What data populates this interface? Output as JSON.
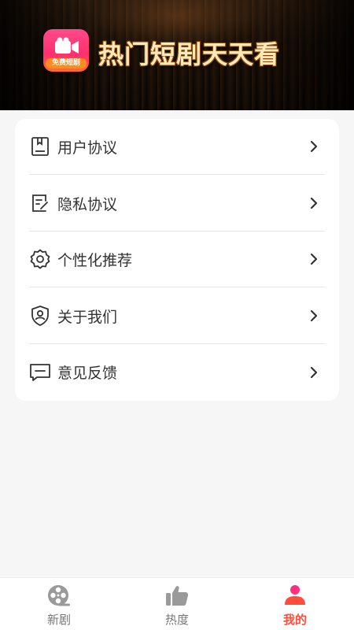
{
  "header": {
    "logo_badge": "免费短剧",
    "title": "热门短剧天天看"
  },
  "menu": {
    "items": [
      {
        "label": "用户协议",
        "icon": "agreement-book-icon"
      },
      {
        "label": "隐私协议",
        "icon": "privacy-document-icon"
      },
      {
        "label": "个性化推荐",
        "icon": "settings-gear-icon"
      },
      {
        "label": "关于我们",
        "icon": "shield-user-icon"
      },
      {
        "label": "意见反馈",
        "icon": "feedback-message-icon"
      }
    ]
  },
  "bottom_nav": {
    "items": [
      {
        "label": "新剧",
        "icon": "film-reel-icon",
        "active": false
      },
      {
        "label": "热度",
        "icon": "thumbs-up-icon",
        "active": false
      },
      {
        "label": "我的",
        "icon": "user-profile-icon",
        "active": true
      }
    ],
    "colors": {
      "active": "#ff4d3d",
      "inactive": "#777777"
    }
  }
}
